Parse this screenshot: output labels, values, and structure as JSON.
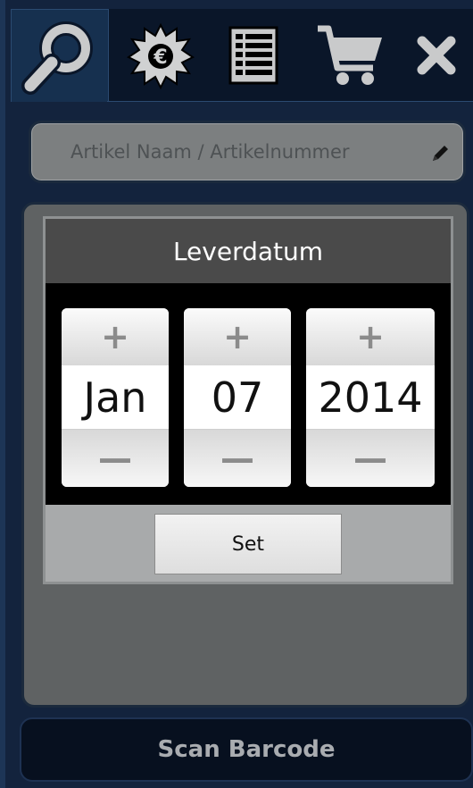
{
  "toolbar": {
    "tabs": [
      {
        "icon": "search-icon",
        "active": true
      },
      {
        "icon": "euro-burst-icon",
        "active": false
      },
      {
        "icon": "list-icon",
        "active": false
      },
      {
        "icon": "cart-icon",
        "active": false
      },
      {
        "icon": "close-icon",
        "active": false
      }
    ]
  },
  "search": {
    "placeholder": "Artikel Naam / Artikelnummer",
    "icon": "pencil-icon"
  },
  "dialog": {
    "title": "Leverdatum",
    "month": "Jan",
    "day": "07",
    "year": "2014",
    "plus": "+",
    "minus": "—",
    "set_label": "Set"
  },
  "scan": {
    "label": "Scan Barcode"
  },
  "colors": {
    "background": "#13233d",
    "dialog_header": "#4a4a4a",
    "panel": "#5f6263"
  }
}
